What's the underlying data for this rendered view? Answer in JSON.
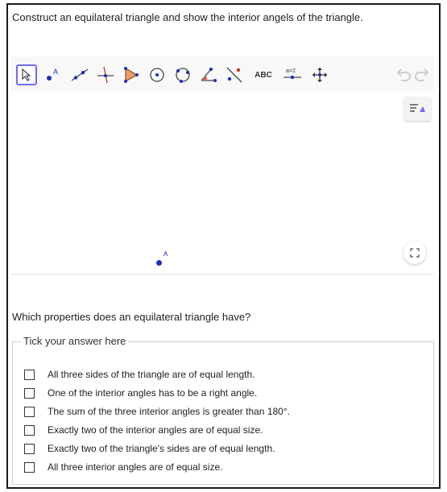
{
  "question": "Construct an equilateral triangle and show the interior angels of the triangle.",
  "toolbar": {
    "tools": [
      {
        "name": "move-tool",
        "selected": true
      },
      {
        "name": "point-tool",
        "label": "A"
      },
      {
        "name": "line-tool"
      },
      {
        "name": "perpendicular-tool"
      },
      {
        "name": "polygon-tool"
      },
      {
        "name": "circle-tool"
      },
      {
        "name": "circle-through-points-tool"
      },
      {
        "name": "angle-tool"
      },
      {
        "name": "reflect-tool"
      },
      {
        "name": "text-tool",
        "label": "ABC"
      },
      {
        "name": "slider-tool",
        "label": "a=2"
      },
      {
        "name": "move-graphics-tool"
      }
    ],
    "undo": "undo-icon",
    "redo": "redo-icon"
  },
  "graphics": {
    "point_label": "A",
    "accent": "#1f30b0"
  },
  "question2": "Which properties does an equilateral triangle have?",
  "answers": {
    "legend": "Tick your answer here",
    "options": [
      "All three sides of the triangle are of equal length.",
      "One of the interior angles has to be a right angle.",
      "The sum of the three interior angles is greater than 180°.",
      "Exactly two of the interior angles are of equal size.",
      "Exactly two of the triangle's sides are of equal length.",
      "All three interior angles are of equal size."
    ]
  }
}
